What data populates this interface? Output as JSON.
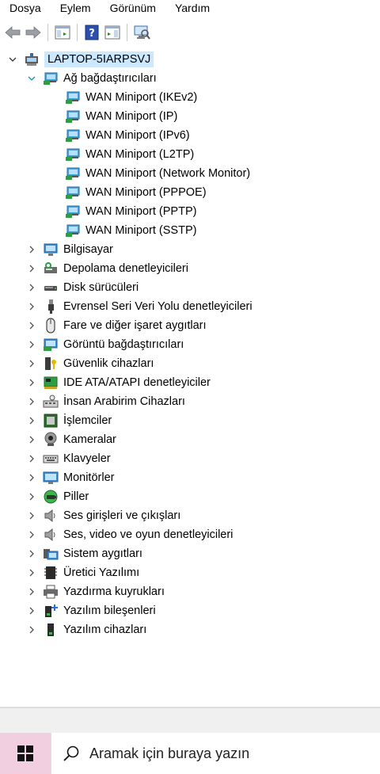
{
  "menu": [
    "Dosya",
    "Eylem",
    "Görünüm",
    "Yardım"
  ],
  "tree": {
    "root": "LAPTOP-5IARPSVJ",
    "expanded_category": "Ağ bağdaştırıcıları",
    "network_children": [
      "WAN Miniport (IKEv2)",
      "WAN Miniport (IP)",
      "WAN Miniport (IPv6)",
      "WAN Miniport (L2TP)",
      "WAN Miniport (Network Monitor)",
      "WAN Miniport (PPPOE)",
      "WAN Miniport (PPTP)",
      "WAN Miniport (SSTP)"
    ],
    "categories": [
      {
        "label": "Bilgisayar",
        "icon": "computer-icon"
      },
      {
        "label": "Depolama denetleyicileri",
        "icon": "storage-controller-icon"
      },
      {
        "label": "Disk sürücüleri",
        "icon": "disk-drive-icon"
      },
      {
        "label": "Evrensel Seri Veri Yolu denetleyicileri",
        "icon": "usb-icon"
      },
      {
        "label": "Fare ve diğer işaret aygıtları",
        "icon": "mouse-icon"
      },
      {
        "label": "Görüntü bağdaştırıcıları",
        "icon": "display-adapter-icon"
      },
      {
        "label": "Güvenlik cihazları",
        "icon": "security-device-icon"
      },
      {
        "label": "IDE ATA/ATAPI denetleyiciler",
        "icon": "ide-controller-icon"
      },
      {
        "label": "İnsan Arabirim Cihazları",
        "icon": "hid-icon"
      },
      {
        "label": "İşlemciler",
        "icon": "processor-icon"
      },
      {
        "label": "Kameralar",
        "icon": "camera-icon"
      },
      {
        "label": "Klavyeler",
        "icon": "keyboard-icon"
      },
      {
        "label": "Monitörler",
        "icon": "monitor-icon"
      },
      {
        "label": "Piller",
        "icon": "battery-icon"
      },
      {
        "label": "Ses girişleri ve çıkışları",
        "icon": "speaker-icon"
      },
      {
        "label": "Ses, video ve oyun denetleyicileri",
        "icon": "sound-controller-icon"
      },
      {
        "label": "Sistem aygıtları",
        "icon": "system-device-icon"
      },
      {
        "label": "Üretici Yazılımı",
        "icon": "firmware-icon"
      },
      {
        "label": "Yazdırma kuyrukları",
        "icon": "printer-icon"
      },
      {
        "label": "Yazılım bileşenleri",
        "icon": "software-component-icon"
      },
      {
        "label": "Yazılım cihazları",
        "icon": "software-device-icon"
      }
    ]
  },
  "taskbar": {
    "search_placeholder": "Aramak için buraya yazın"
  }
}
